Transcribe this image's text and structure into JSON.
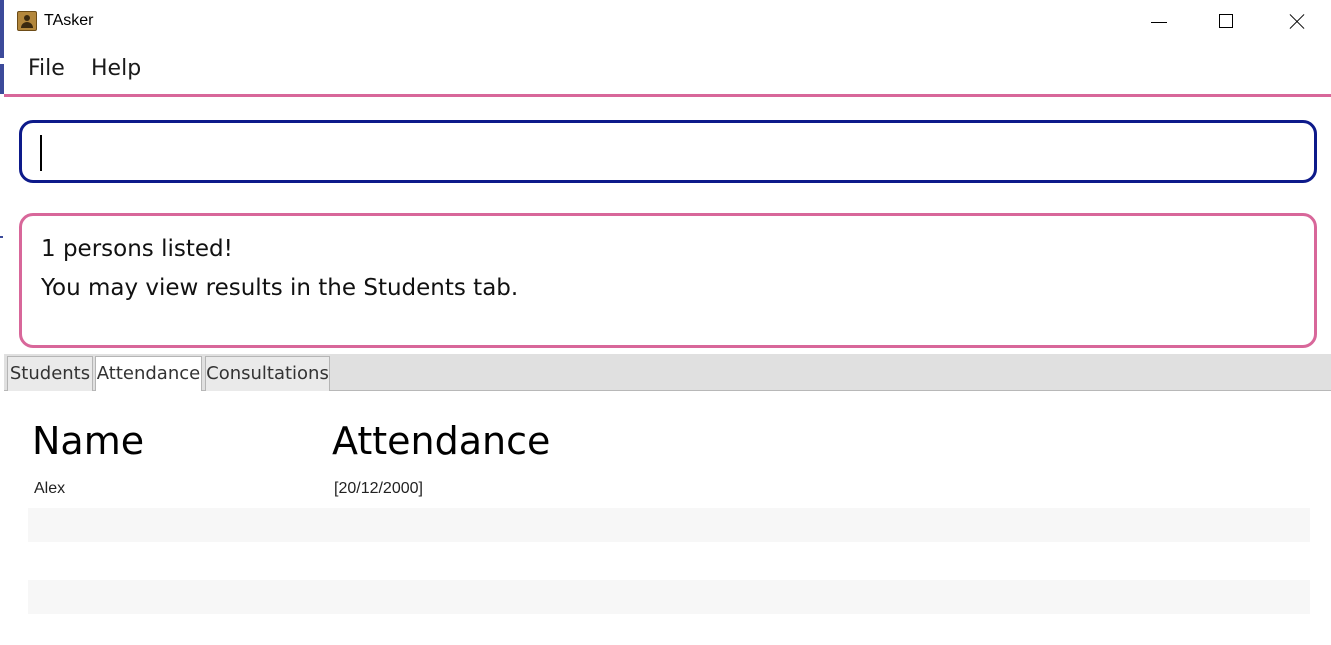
{
  "window": {
    "title": "TAsker"
  },
  "menu": {
    "items": [
      "File",
      "Help"
    ]
  },
  "command": {
    "value": "",
    "placeholder": ""
  },
  "result": {
    "lines": [
      "1 persons listed!",
      "You may view results in the Students tab."
    ]
  },
  "tabs": {
    "items": [
      {
        "label": "Students"
      },
      {
        "label": "Attendance"
      },
      {
        "label": "Consultations"
      }
    ],
    "active": "Attendance"
  },
  "attendance_table": {
    "headers": [
      "Name",
      "Attendance"
    ],
    "rows": [
      {
        "name": "Alex",
        "attendance": "[20/12/2000]"
      }
    ]
  },
  "colors": {
    "accent_pink": "#d8679a",
    "command_border": "#0d1a8a"
  },
  "icons": {
    "app": "person-card-icon",
    "minimize": "minimize-icon",
    "maximize": "maximize-icon",
    "close": "close-icon"
  }
}
